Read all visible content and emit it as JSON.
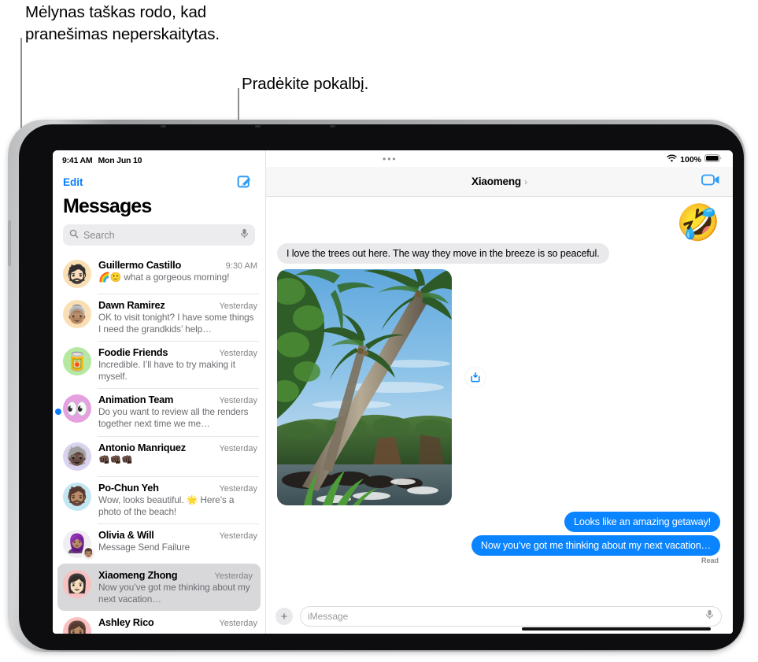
{
  "callouts": [
    {
      "id": "unread-dot-callout",
      "text": "Mėlynas taškas rodo, kad\npranešimas neperskaitytas."
    },
    {
      "id": "compose-callout",
      "text": "Pradėkite pokalbį."
    }
  ],
  "sidebar": {
    "status_time": "9:41 AM",
    "status_date": "Mon Jun 10",
    "edit_label": "Edit",
    "title": "Messages",
    "search_placeholder": "Search",
    "search_icon": "magnifier-icon",
    "mic_icon": "microphone-icon",
    "compose_icon": "compose-pencil-icon",
    "conversations": [
      {
        "name": "Guillermo Castillo",
        "time": "9:30 AM",
        "preview": "🌈🙂 what a gorgeous morning!",
        "avatar_emoji": "🧔🏻",
        "avatar_bg": "#fbdfb4",
        "unread": false,
        "selected": false
      },
      {
        "name": "Dawn Ramirez",
        "time": "Yesterday",
        "preview": "OK to visit tonight? I have some things I need the grandkids’ help…",
        "avatar_emoji": "👵🏽",
        "avatar_bg": "#fbdfb4",
        "unread": false,
        "selected": false
      },
      {
        "name": "Foodie Friends",
        "time": "Yesterday",
        "preview": "Incredible. I’ll have to try making it myself.",
        "avatar_emoji": "🥫",
        "avatar_bg": "#b5e8a0",
        "unread": false,
        "selected": false
      },
      {
        "name": "Animation Team",
        "time": "Yesterday",
        "preview": "Do you want to review all the renders together next time we me…",
        "avatar_emoji": "👀",
        "avatar_bg": "#e6a0e0",
        "unread": true,
        "selected": false
      },
      {
        "name": "Antonio Manriquez",
        "time": "Yesterday",
        "preview": "👊🏿👊🏿👊🏿",
        "avatar_emoji": "🧓🏿",
        "avatar_bg": "#d9d2f0",
        "unread": false,
        "selected": false
      },
      {
        "name": "Po-Chun Yeh",
        "time": "Yesterday",
        "preview": "Wow, looks beautiful. 🌟 Here’s a photo of the beach!",
        "avatar_emoji": "🧔🏽",
        "avatar_bg": "#c3e6f3",
        "unread": false,
        "selected": false
      },
      {
        "name": "Olivia & Will",
        "time": "Yesterday",
        "preview": "Message Send Failure",
        "avatar_emoji": "🧕🏽",
        "avatar_sub_emoji": "👨🏽",
        "avatar_bg": "#f1eef3",
        "unread": false,
        "selected": false
      },
      {
        "name": "Xiaomeng Zhong",
        "time": "Yesterday",
        "preview": "Now you’ve got me thinking about my next vacation…",
        "avatar_emoji": "👩🏻",
        "avatar_bg": "#f8c0c0",
        "unread": false,
        "selected": true
      },
      {
        "name": "Ashley Rico",
        "time": "Yesterday",
        "preview": "",
        "avatar_emoji": "👩🏽",
        "avatar_bg": "#f8c0c0",
        "unread": false,
        "selected": false
      }
    ]
  },
  "conversation": {
    "wifi_icon": "wifi-icon",
    "battery_level": "100%",
    "battery_icon": "battery-full-icon",
    "handle_icon": "window-handle-dots",
    "title": "Xiaomeng",
    "chevron": "›",
    "facetime_icon": "video-camera-icon",
    "reaction_emoji": "🤣",
    "messages": [
      {
        "direction": "in",
        "text": "I love the trees out here. The way they move in the breeze is so peaceful."
      },
      {
        "direction": "in",
        "type": "photo",
        "alt": "Palm trees leaning over a rocky tropical shoreline with blue sky"
      },
      {
        "direction": "out",
        "text": "Looks like an amazing getaway!"
      },
      {
        "direction": "out",
        "text": "Now you’ve got me thinking about my next vacation…"
      }
    ],
    "read_receipt": "Read",
    "save_icon": "save-to-photos-icon",
    "composer": {
      "plus_icon": "plus-icon",
      "placeholder": "iMessage",
      "mic_icon": "microphone-icon"
    }
  },
  "colors": {
    "accent_blue": "#0a7cff",
    "bubble_out": "#0a84ff",
    "bubble_in": "#e9e9eb",
    "unread_dot": "#0a7cff"
  }
}
